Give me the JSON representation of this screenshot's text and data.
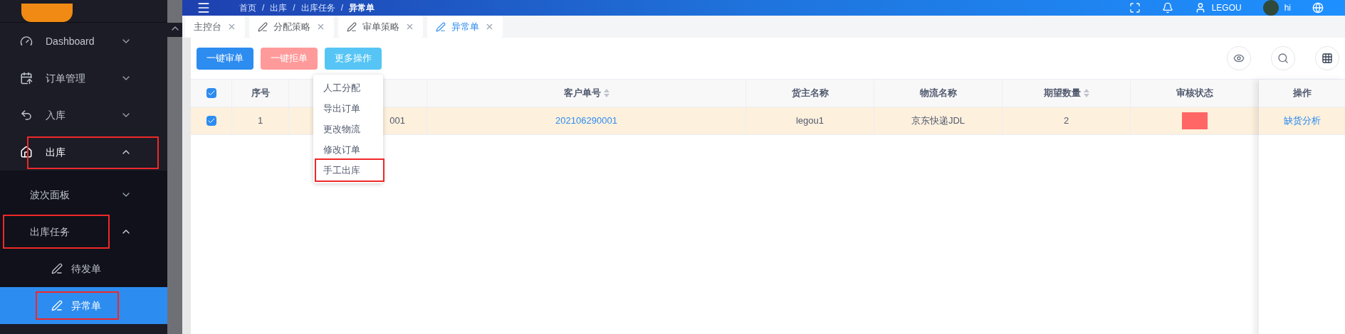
{
  "header": {
    "breadcrumbs": [
      {
        "kind": "link",
        "text": "首页"
      },
      {
        "kind": "separator",
        "text": "/"
      },
      {
        "kind": "link",
        "text": "出库"
      },
      {
        "kind": "separator",
        "text": "/"
      },
      {
        "kind": "link",
        "text": "出库任务"
      },
      {
        "kind": "separator",
        "text": "/"
      },
      {
        "kind": "current",
        "text": "异常单"
      }
    ],
    "user": "LEGOU",
    "greeting": "hi"
  },
  "sidebar": {
    "items": [
      {
        "label": "Dashboard",
        "expanded": false,
        "highlighted": false
      },
      {
        "label": "订单管理",
        "expanded": false,
        "highlighted": false
      },
      {
        "label": "入库",
        "expanded": false,
        "highlighted": false
      },
      {
        "label": "出库",
        "expanded": true,
        "highlighted": true,
        "children": [
          {
            "label": "波次面板",
            "expanded": false,
            "highlighted": false
          },
          {
            "label": "出库任务",
            "expanded": true,
            "highlighted": true,
            "children": [
              {
                "label": "待发单",
                "selected": false,
                "highlighted": false
              },
              {
                "label": "异常单",
                "selected": true,
                "highlighted": true
              }
            ]
          }
        ]
      }
    ]
  },
  "tabs": [
    {
      "label": "主控台",
      "icon": false,
      "selected": false
    },
    {
      "label": "分配策略",
      "icon": true,
      "selected": false
    },
    {
      "label": "审单策略",
      "icon": true,
      "selected": false
    },
    {
      "label": "异常单",
      "icon": true,
      "selected": true
    }
  ],
  "toolbar": {
    "buttons": [
      {
        "label": "一键审单",
        "kind": "primary"
      },
      {
        "label": "一键拒单",
        "kind": "danger"
      },
      {
        "label": "更多操作",
        "kind": "info"
      }
    ],
    "menu": [
      {
        "label": "人工分配",
        "highlighted": false
      },
      {
        "label": "导出订单",
        "highlighted": false
      },
      {
        "label": "更改物流",
        "highlighted": false
      },
      {
        "label": "修改订单",
        "highlighted": false
      },
      {
        "label": "手工出库",
        "highlighted": true
      }
    ]
  },
  "table": {
    "all_checked": true,
    "columns": [
      {
        "label": "序号",
        "sortable": false
      },
      {
        "sortable": false
      },
      {
        "label": "客户单号",
        "sortable": true
      },
      {
        "label": "货主名称",
        "sortable": false
      },
      {
        "label": "物流名称",
        "sortable": false
      },
      {
        "label": "期望数量",
        "sortable": true
      },
      {
        "label": "审核状态",
        "sortable": false
      }
    ],
    "action_column": "操作",
    "rows": [
      {
        "checked": true,
        "cells": [
          "1",
          "001",
          "202106290001",
          "legou1",
          "京东快递JDL",
          "2"
        ],
        "action": "缺货分析"
      }
    ]
  }
}
